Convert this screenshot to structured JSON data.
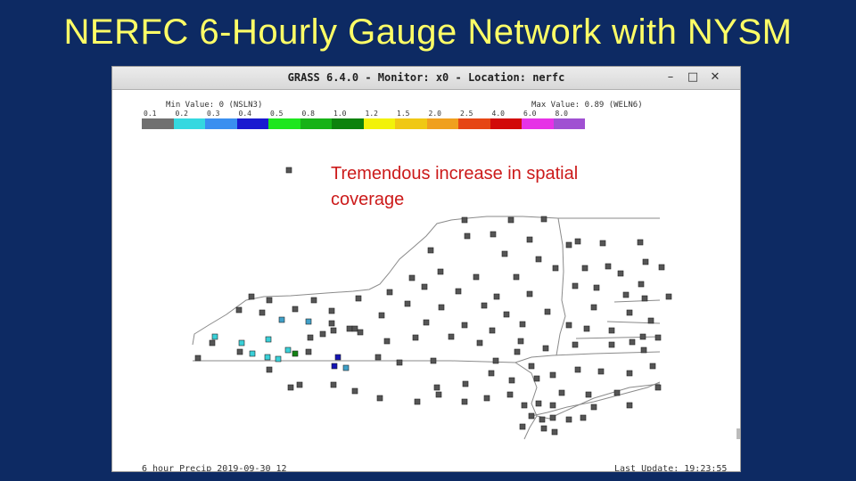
{
  "slide": {
    "title": "NERFC 6-Hourly Gauge Network with NYSM"
  },
  "window": {
    "title": "GRASS 6.4.0 - Monitor: x0 - Location: nerfc",
    "controls": {
      "minimize": "–",
      "maximize": "□",
      "close": "✕"
    }
  },
  "legend": {
    "min_label": "Min Value: 0 (NSLN3)",
    "max_label": "Max Value: 0.89 (WELN6)",
    "ticks": [
      "0.1",
      "0.2",
      "0.3",
      "0.4",
      "0.5",
      "0.8",
      "1.0",
      "1.2",
      "1.5",
      "2.0",
      "2.5",
      "4.0",
      "6.0",
      "8.0"
    ],
    "colors": [
      "#707070",
      "#34d8e0",
      "#3a8ff0",
      "#1a1ad0",
      "#1ee61e",
      "#17b217",
      "#0d820d",
      "#f2f20a",
      "#f0c814",
      "#f0a01e",
      "#e64614",
      "#d20a0a",
      "#e632e6",
      "#a050d2"
    ]
  },
  "map": {
    "annotation": "Tremendous increase in spatial coverage",
    "gauge_colors": {
      "gray": "#555555",
      "cyan": "#3ad0d8",
      "teal": "#40a0c8",
      "blue": "#1414b4",
      "green": "#148214"
    }
  },
  "footer": {
    "left": "6 hour Precip 2019-09-30 12",
    "right": "Last Update: 19:23:55"
  }
}
